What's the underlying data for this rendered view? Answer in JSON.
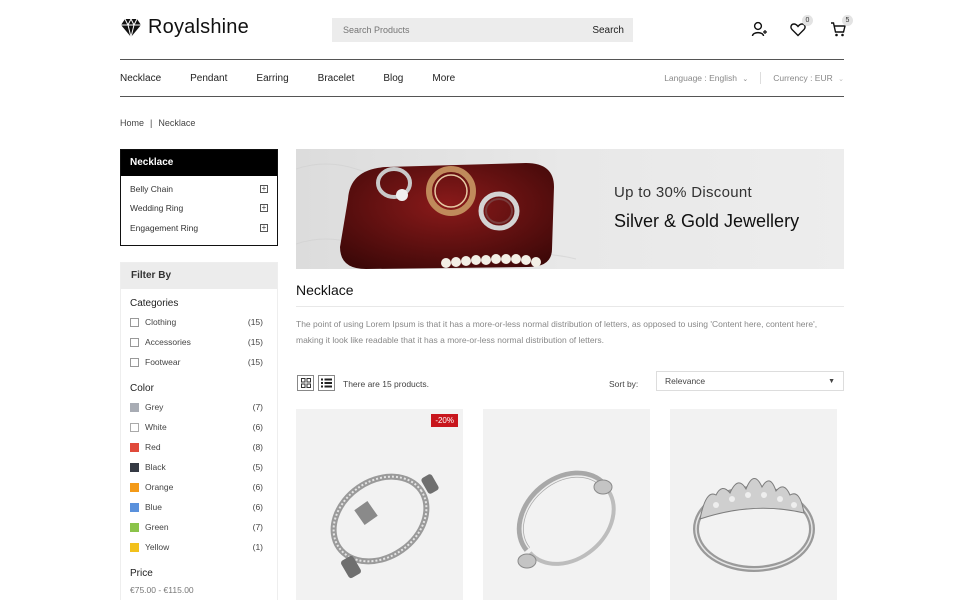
{
  "header": {
    "brand": "Royalshine",
    "search_placeholder": "Search Products",
    "search_label": "Search",
    "wishlist_count": "0",
    "cart_count": "5"
  },
  "nav": {
    "items": [
      "Necklace",
      "Pendant",
      "Earring",
      "Bracelet",
      "Blog",
      "More"
    ],
    "language": "Language : English",
    "currency": "Currency : EUR"
  },
  "breadcrumb": {
    "home": "Home",
    "sep": "|",
    "current": "Necklace"
  },
  "category_box": {
    "title": "Necklace",
    "items": [
      "Belly Chain",
      "Wedding Ring",
      "Engagement Ring"
    ]
  },
  "filter": {
    "title": "Filter By",
    "categories_title": "Categories",
    "categories": [
      {
        "label": "Clothing",
        "count": "(15)"
      },
      {
        "label": "Accessories",
        "count": "(15)"
      },
      {
        "label": "Footwear",
        "count": "(15)"
      }
    ],
    "color_title": "Color",
    "colors": [
      {
        "label": "Grey",
        "count": "(7)",
        "swatch": "#a8acb4"
      },
      {
        "label": "White",
        "count": "(6)",
        "swatch": "#ffffff"
      },
      {
        "label": "Red",
        "count": "(8)",
        "swatch": "#e04a3b"
      },
      {
        "label": "Black",
        "count": "(5)",
        "swatch": "#353a44"
      },
      {
        "label": "Orange",
        "count": "(6)",
        "swatch": "#f39a18"
      },
      {
        "label": "Blue",
        "count": "(6)",
        "swatch": "#5a91dc"
      },
      {
        "label": "Green",
        "count": "(7)",
        "swatch": "#8bc34a"
      },
      {
        "label": "Yellow",
        "count": "(1)",
        "swatch": "#f2c11c"
      }
    ],
    "price_title": "Price",
    "price_range": "€75.00 - €115.00"
  },
  "banner": {
    "line1": "Up to 30% Discount",
    "line2": "Silver & Gold Jewellery"
  },
  "main": {
    "title": "Necklace",
    "description": "The point of using Lorem Ipsum is that it has a more-or-less normal distribution of letters, as opposed to using 'Content here, content here', making it look like readable that it has a more-or-less normal distribution of letters.",
    "product_count": "There are 15 products.",
    "sort_label": "Sort by:",
    "sort_value": "Relevance"
  },
  "products": [
    {
      "badge": "-20%"
    },
    {
      "badge": ""
    },
    {
      "badge": ""
    }
  ]
}
